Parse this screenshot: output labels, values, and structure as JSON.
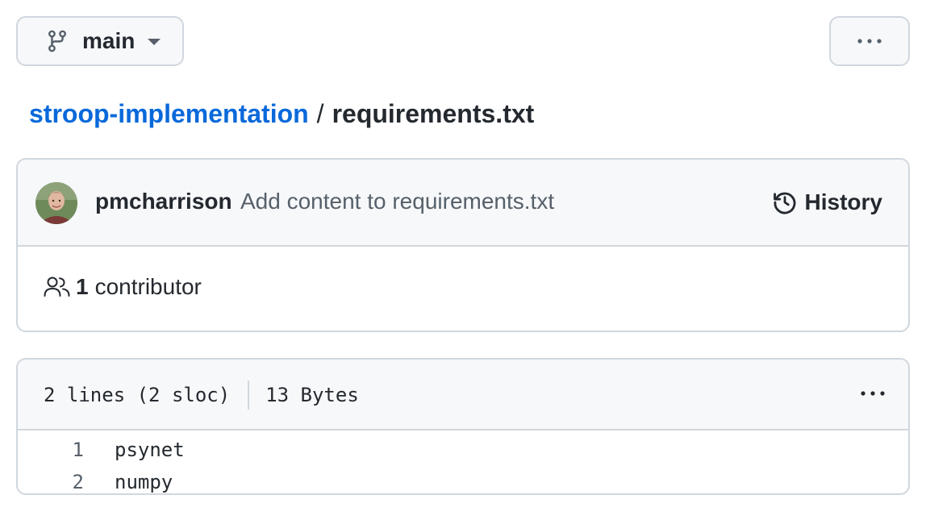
{
  "branch": {
    "name": "main",
    "icon": "git-branch-icon"
  },
  "top_more": {
    "icon": "kebab-horizontal-icon"
  },
  "breadcrumb": {
    "repo": "stroop-implementation",
    "separator": "/",
    "file": "requirements.txt"
  },
  "commit": {
    "author": "pmcharrison",
    "message": "Add content to requirements.txt",
    "history_label": "History"
  },
  "contributors": {
    "count": "1",
    "label": "contributor"
  },
  "file": {
    "lines_info": "2 lines (2 sloc)",
    "size": "13 Bytes",
    "lines": [
      {
        "number": "1",
        "text": "psynet"
      },
      {
        "number": "2",
        "text": "numpy"
      }
    ]
  },
  "colors": {
    "link": "#0969da",
    "border": "#d0d7de",
    "header_bg": "#f6f8fa",
    "muted": "#57606a",
    "text": "#24292f"
  }
}
